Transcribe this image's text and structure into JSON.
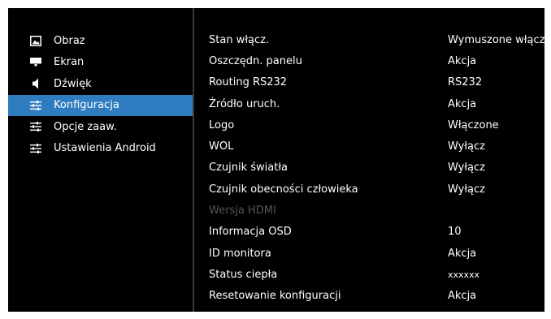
{
  "sidebar": {
    "items": [
      {
        "label": "Obraz",
        "icon": "image-icon"
      },
      {
        "label": "Ekran",
        "icon": "screen-icon"
      },
      {
        "label": "Dźwięk",
        "icon": "speaker-icon"
      },
      {
        "label": "Konfiguracja",
        "icon": "sliders-icon",
        "selected": true
      },
      {
        "label": "Opcje zaaw.",
        "icon": "sliders-icon"
      },
      {
        "label": "Ustawienia Android",
        "icon": "sliders-icon"
      }
    ]
  },
  "settings": {
    "rows": [
      {
        "name": "Stan włącz.",
        "value": "Wymuszone włącz."
      },
      {
        "name": "Oszczędn. panelu",
        "value": "Akcja"
      },
      {
        "name": "Routing RS232",
        "value": "RS232"
      },
      {
        "name": "Źródło uruch.",
        "value": "Akcja"
      },
      {
        "name": "Logo",
        "value": "Włączone"
      },
      {
        "name": "WOL",
        "value": "Wyłącz"
      },
      {
        "name": "Czujnik światła",
        "value": "Wyłącz"
      },
      {
        "name": "Czujnik obecności człowieka",
        "value": "Wyłącz"
      },
      {
        "name": "Wersja HDMI",
        "value": "",
        "disabled": true
      },
      {
        "name": "Informacja OSD",
        "value": "10"
      },
      {
        "name": "ID monitora",
        "value": "Akcja"
      },
      {
        "name": "Status ciepła",
        "value": "xxxxxx"
      },
      {
        "name": "Resetowanie konfiguracji",
        "value": "Akcja"
      }
    ]
  },
  "colors": {
    "background": "#000000",
    "selection": "#2f7cc0",
    "text": "#ffffff",
    "disabled_text": "#555555"
  }
}
